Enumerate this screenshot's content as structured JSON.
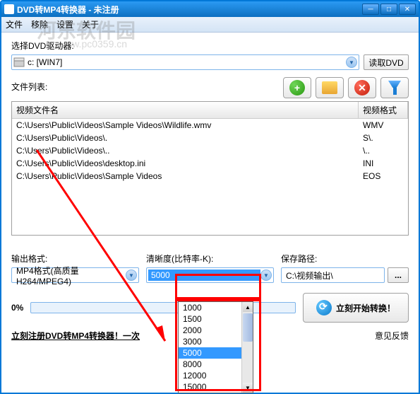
{
  "window": {
    "title": "DVD转MP4转换器 - 未注册"
  },
  "watermark": {
    "main": "河东软件园",
    "sub": "www.pc0359.cn"
  },
  "menu": {
    "file": "文件",
    "remove": "移除",
    "settings": "设置",
    "about": "关于"
  },
  "drive": {
    "label": "选择DVD驱动器:",
    "value": "c: [WIN7]",
    "read_btn": "读取DVD"
  },
  "filelist": {
    "label": "文件列表:",
    "col_name": "视频文件名",
    "col_format": "视频格式",
    "rows": [
      {
        "name": "C:\\Users\\Public\\Videos\\Sample Videos\\Wildlife.wmv",
        "format": "WMV"
      },
      {
        "name": "C:\\Users\\Public\\Videos\\.",
        "format": "S\\."
      },
      {
        "name": "C:\\Users\\Public\\Videos\\..",
        "format": "\\.."
      },
      {
        "name": "C:\\Users\\Public\\Videos\\desktop.ini",
        "format": "INI"
      },
      {
        "name": "C:\\Users\\Public\\Videos\\Sample Videos",
        "format": "EOS"
      }
    ]
  },
  "output": {
    "format_label": "输出格式:",
    "format_value": "MP4格式(高质量H264/MPEG4)",
    "bitrate_label": "清晰度(比特率-K):",
    "bitrate_value": "5000",
    "bitrate_options": [
      "1000",
      "1500",
      "2000",
      "3000",
      "5000",
      "8000",
      "12000",
      "15000"
    ],
    "path_label": "保存路径:",
    "path_value": "C:\\视频输出\\",
    "browse": "..."
  },
  "progress": {
    "label": "0%",
    "convert_btn": "立刻开始转换！"
  },
  "footer": {
    "register": "立刻注册DVD转MP4转换器！一次",
    "feedback": "意见反馈"
  }
}
